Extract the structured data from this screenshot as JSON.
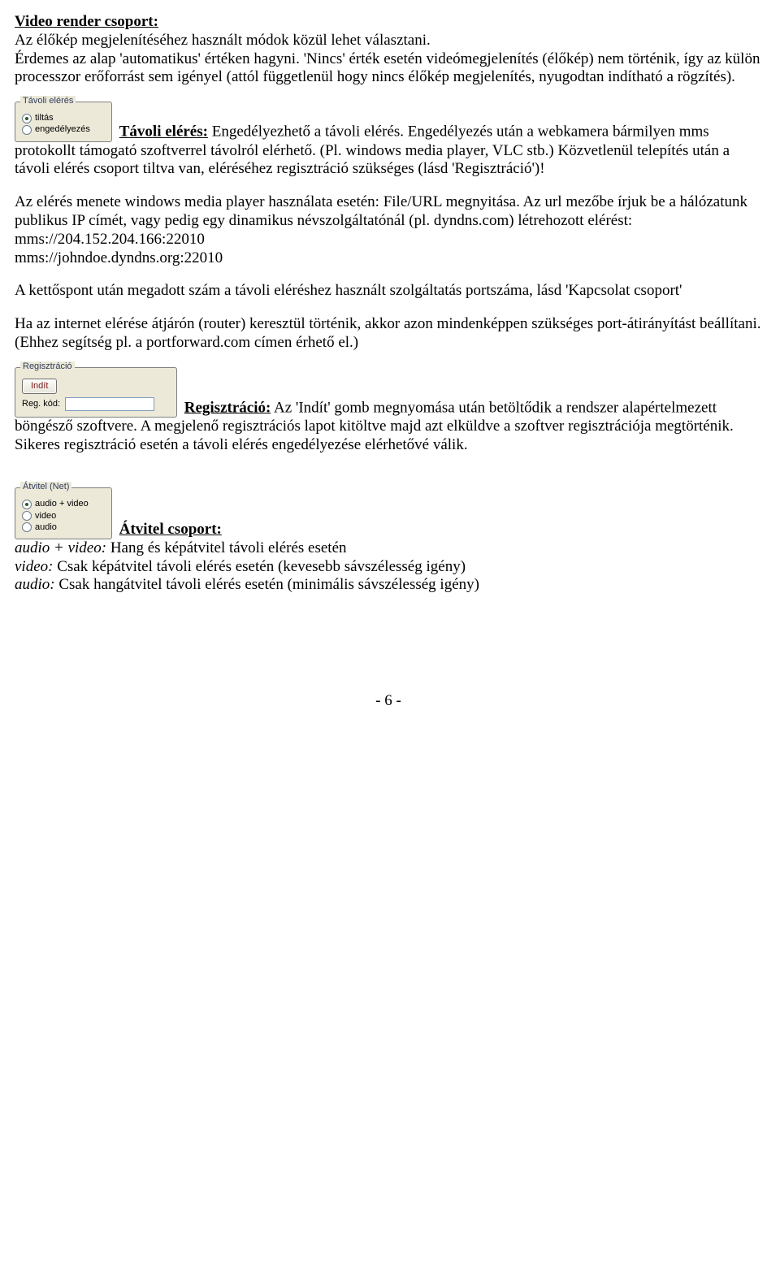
{
  "section1": {
    "title": "Video render csoport:",
    "para1": "Az élőkép megjelenítéséhez használt módok közül lehet választani.",
    "para2": "Érdemes az alap 'automatikus' értéken hagyni. 'Nincs' érték esetén videómegjelenítés (élőkép) nem történik, így az külön processzor erőforrást sem igényel (attól függetlenül hogy nincs élőkép megjelenítés, nyugodtan indítható a rögzítés)."
  },
  "ui_tavoli": {
    "legend": "Távoli elérés",
    "opt1": "tiltás",
    "opt2": "engedélyezés"
  },
  "section2": {
    "title": "Távoli elérés:",
    "after_title": " Engedélyezhető a távoli elérés. Engedélyezés után a webkamera bármilyen mms protokollt támogató szoftverrel távolról elérhető. (Pl. windows media player, VLC stb.) Közvetlenül telepítés után a távoli elérés csoport tiltva van, eléréséhez regisztráció szükséges (lásd 'Regisztráció')!",
    "para2a": "Az elérés menete windows media player használata esetén: File/URL megnyitása. Az url mezőbe írjuk be a hálózatunk publikus IP címét, vagy pedig egy dinamikus névszolgáltatónál (pl. dyndns.com) létrehozott elérést:",
    "mms1": "mms://204.152.204.166:22010",
    "mms2": "mms://johndoe.dyndns.org:22010",
    "para3": "A kettőspont után megadott szám a távoli eléréshez használt szolgáltatás portszáma, lásd 'Kapcsolat csoport'",
    "para4": "Ha az internet elérése átjárón (router) keresztül történik, akkor azon mindenképpen szükséges port-átirányítást beállítani. (Ehhez segítség pl. a portforward.com címen érhető el.)"
  },
  "ui_reg": {
    "legend": "Regisztráció",
    "btn": "Indít",
    "label": "Reg. kód:"
  },
  "section3": {
    "title": "Regisztráció:",
    "after_title": " Az 'Indít' gomb megnyomása után betöltődik a rendszer alapértelmezett böngésző szoftvere. A megjelenő regisztrációs lapot kitöltve majd azt elküldve a szoftver regisztrációja megtörténik. Sikeres regisztráció esetén a távoli elérés engedélyezése elérhetővé válik."
  },
  "ui_atvitel": {
    "legend": "Átvitel (Net)",
    "opt1": "audio + video",
    "opt2": "video",
    "opt3": "audio"
  },
  "section4": {
    "title": "Átvitel csoport:",
    "row1_label": "audio + video:",
    "row1_text": " Hang és képátvitel távoli elérés esetén",
    "row2_label": "video:",
    "row2_text": " Csak képátvitel távoli elérés esetén (kevesebb sávszélesség igény)",
    "row3_label": "audio:",
    "row3_text": " Csak hangátvitel távoli elérés esetén (minimális sávszélesség igény)"
  },
  "footer": "- 6 -"
}
